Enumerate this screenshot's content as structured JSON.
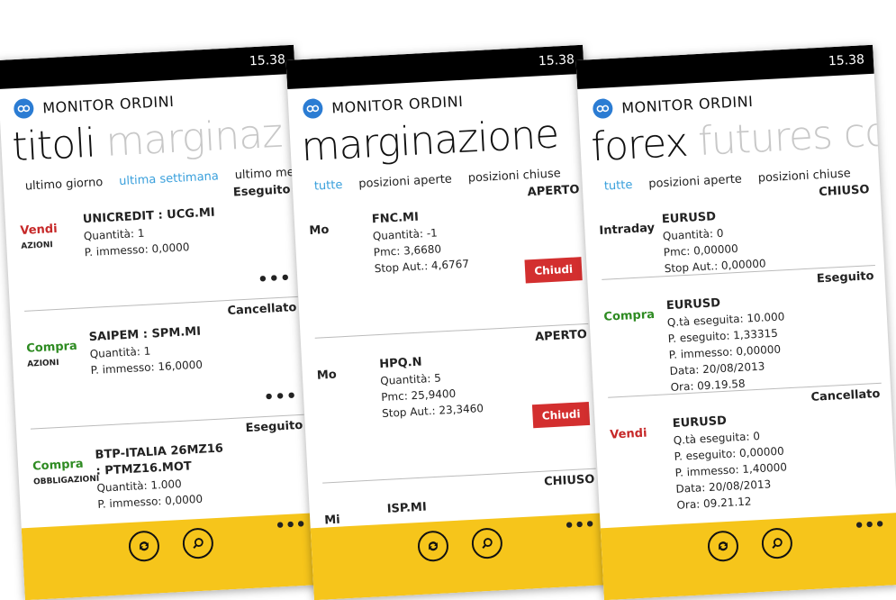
{
  "app_name": "MONITOR ORDINI",
  "time": "15.38",
  "screens": [
    {
      "pivot_active": "titoli",
      "pivot_next": "marginaz",
      "filters": [
        "ultimo giorno",
        "ultima settimana",
        "ultimo mese"
      ],
      "items": [
        {
          "status": "Eseguito",
          "side": "Vendi",
          "category": "AZIONI",
          "name": "UNICREDIT : UCG.MI",
          "lines": [
            "Quantità: 1",
            "P. immesso: 0,0000"
          ]
        },
        {
          "status": "Cancellato",
          "side": "Compra",
          "category": "AZIONI",
          "name": "SAIPEM : SPM.MI",
          "lines": [
            "Quantità: 1",
            "P. immesso: 16,0000"
          ]
        },
        {
          "status": "Eseguito",
          "side": "Compra",
          "category": "OBBLIGAZIONI",
          "name": "BTP-ITALIA 26MZ16 : PTMZ16.MOT",
          "lines": [
            "Quantità: 1.000",
            "P. immesso: 0,0000"
          ]
        }
      ]
    },
    {
      "pivot_active": "marginazione",
      "filters": [
        "tutte",
        "posizioni aperte",
        "posizioni chiuse"
      ],
      "items": [
        {
          "status": "APERTO",
          "side": "Mo",
          "name": "FNC.MI",
          "lines": [
            "Quantità: -1",
            "Pmc: 3,6680",
            "Stop Aut.: 4,6767"
          ],
          "button": "Chiudi"
        },
        {
          "status": "APERTO",
          "side": "Mo",
          "name": "HPQ.N",
          "lines": [
            "Quantità: 5",
            "Pmc: 25,9400",
            "Stop Aut.: 23,3460"
          ],
          "button": "Chiudi"
        },
        {
          "status": "CHIUSO",
          "side": "Mi",
          "name": "ISP.MI",
          "lines": []
        }
      ]
    },
    {
      "pivot_active": "forex",
      "pivot_next": "futures co",
      "filters": [
        "tutte",
        "posizioni aperte",
        "posizioni chiuse"
      ],
      "items": [
        {
          "status": "CHIUSO",
          "side": "Intraday",
          "name": "EURUSD",
          "lines": [
            "Quantità: 0",
            "Pmc: 0,00000",
            "Stop Aut.: 0,00000"
          ]
        },
        {
          "status": "Eseguito",
          "side": "Compra",
          "name": "EURUSD",
          "lines": [
            "Q.tà eseguita: 10.000",
            "P. eseguito: 1,33315",
            "P. immesso: 0,00000",
            "Data: 20/08/2013",
            "Ora: 09.19.58"
          ]
        },
        {
          "status": "Cancellato",
          "side": "Vendi",
          "name": "EURUSD",
          "lines": [
            "Q.tà eseguita: 0",
            "P. eseguito: 0,00000",
            "P. immesso: 1,40000",
            "Data: 20/08/2013",
            "Ora: 09.21.12"
          ]
        }
      ]
    }
  ],
  "more_glyph": "•••",
  "colors": {
    "accent": "#3aa0dc",
    "appbar": "#f6c51b",
    "sell": "#c62828",
    "buy": "#2e8b22",
    "button": "#d32f2f"
  }
}
